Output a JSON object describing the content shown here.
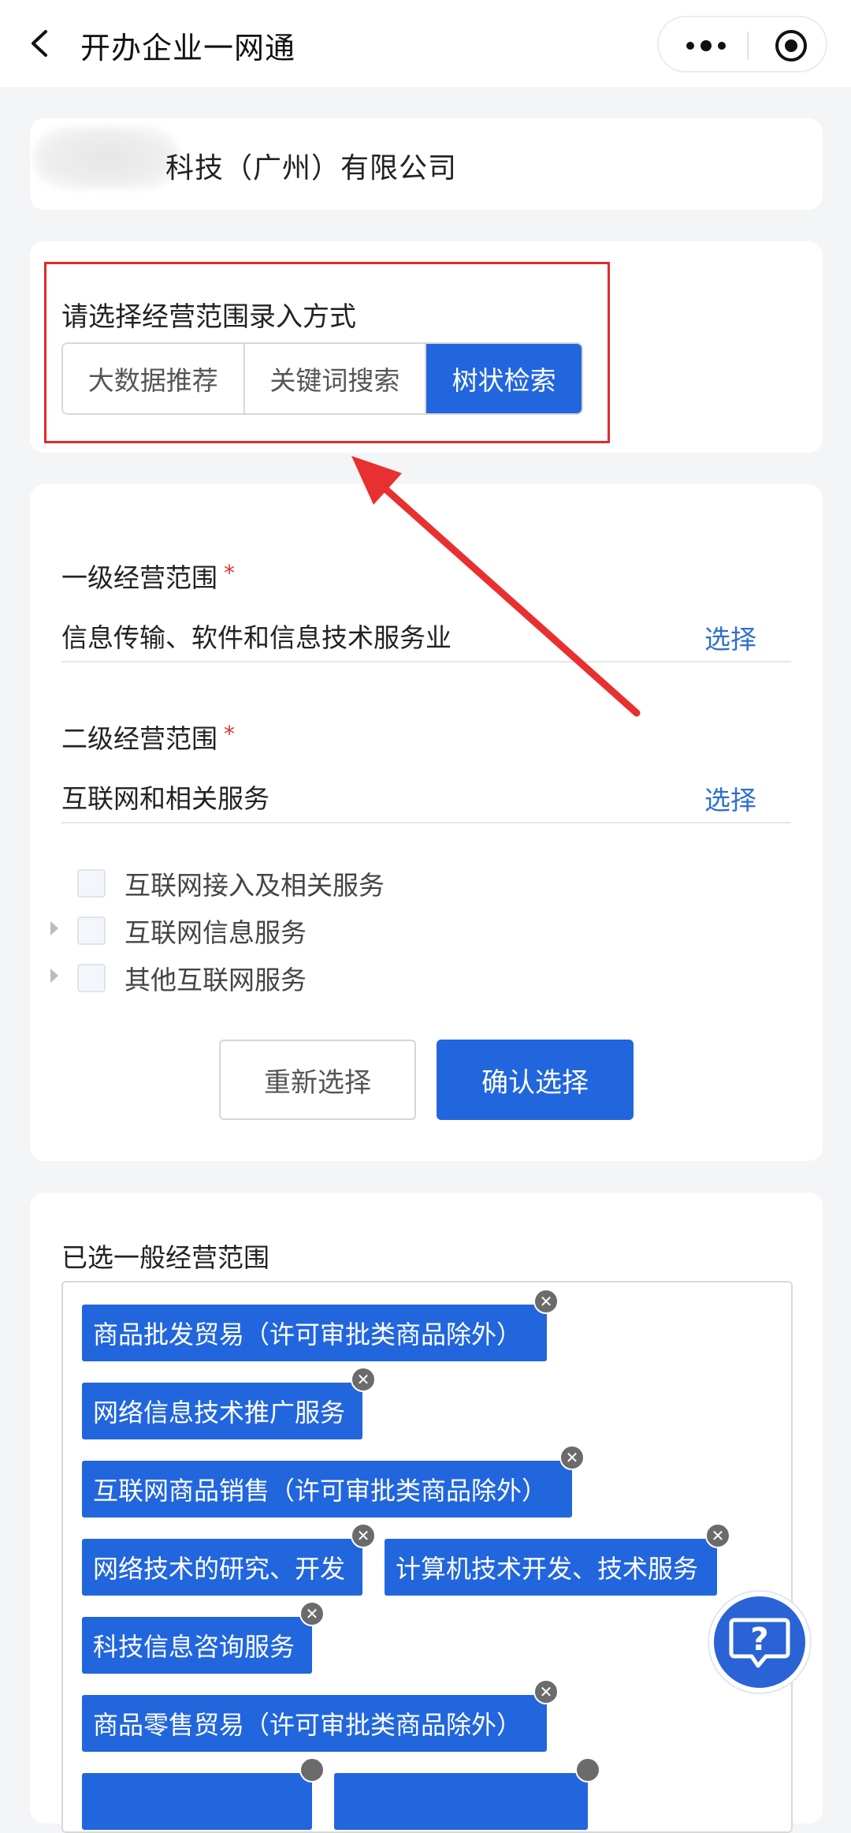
{
  "nav": {
    "title": "开办企业一网通"
  },
  "company": {
    "name_suffix": "科技（广州）有限公司"
  },
  "entry_mode": {
    "label": "请选择经营范围录入方式",
    "options": [
      "大数据推荐",
      "关键词搜索",
      "树状检索"
    ],
    "selected": "树状检索"
  },
  "scope": {
    "level1": {
      "label": "一级经营范围",
      "required_mark": "*",
      "value": "信息传输、软件和信息技术服务业",
      "select_label": "选择"
    },
    "level2": {
      "label": "二级经营范围",
      "required_mark": "*",
      "value": "互联网和相关服务",
      "select_label": "选择"
    },
    "tree_items": [
      {
        "label": "互联网接入及相关服务",
        "expandable": false,
        "checked": false
      },
      {
        "label": "互联网信息服务",
        "expandable": true,
        "checked": false
      },
      {
        "label": "其他互联网服务",
        "expandable": true,
        "checked": false
      }
    ],
    "reset_label": "重新选择",
    "confirm_label": "确认选择"
  },
  "selected_scope": {
    "title": "已选一般经营范围",
    "tags": [
      "商品批发贸易（许可审批类商品除外）",
      "网络信息技术推广服务",
      "互联网商品销售（许可审批类商品除外）",
      "网络技术的研究、开发",
      "计算机技术开发、技术服务",
      "科技信息咨询服务",
      "商品零售贸易（许可审批类商品除外）"
    ],
    "remove_symbol": "✕"
  },
  "colors": {
    "accent": "#2266dd",
    "link": "#2f6fd0",
    "highlight": "#e22b2b",
    "required": "#e03131"
  },
  "icons": [
    "back-arrow-icon",
    "more-dots-icon",
    "target-icon",
    "chevron-right-icon",
    "remove-icon",
    "help-question-icon",
    "annotation-arrow"
  ]
}
